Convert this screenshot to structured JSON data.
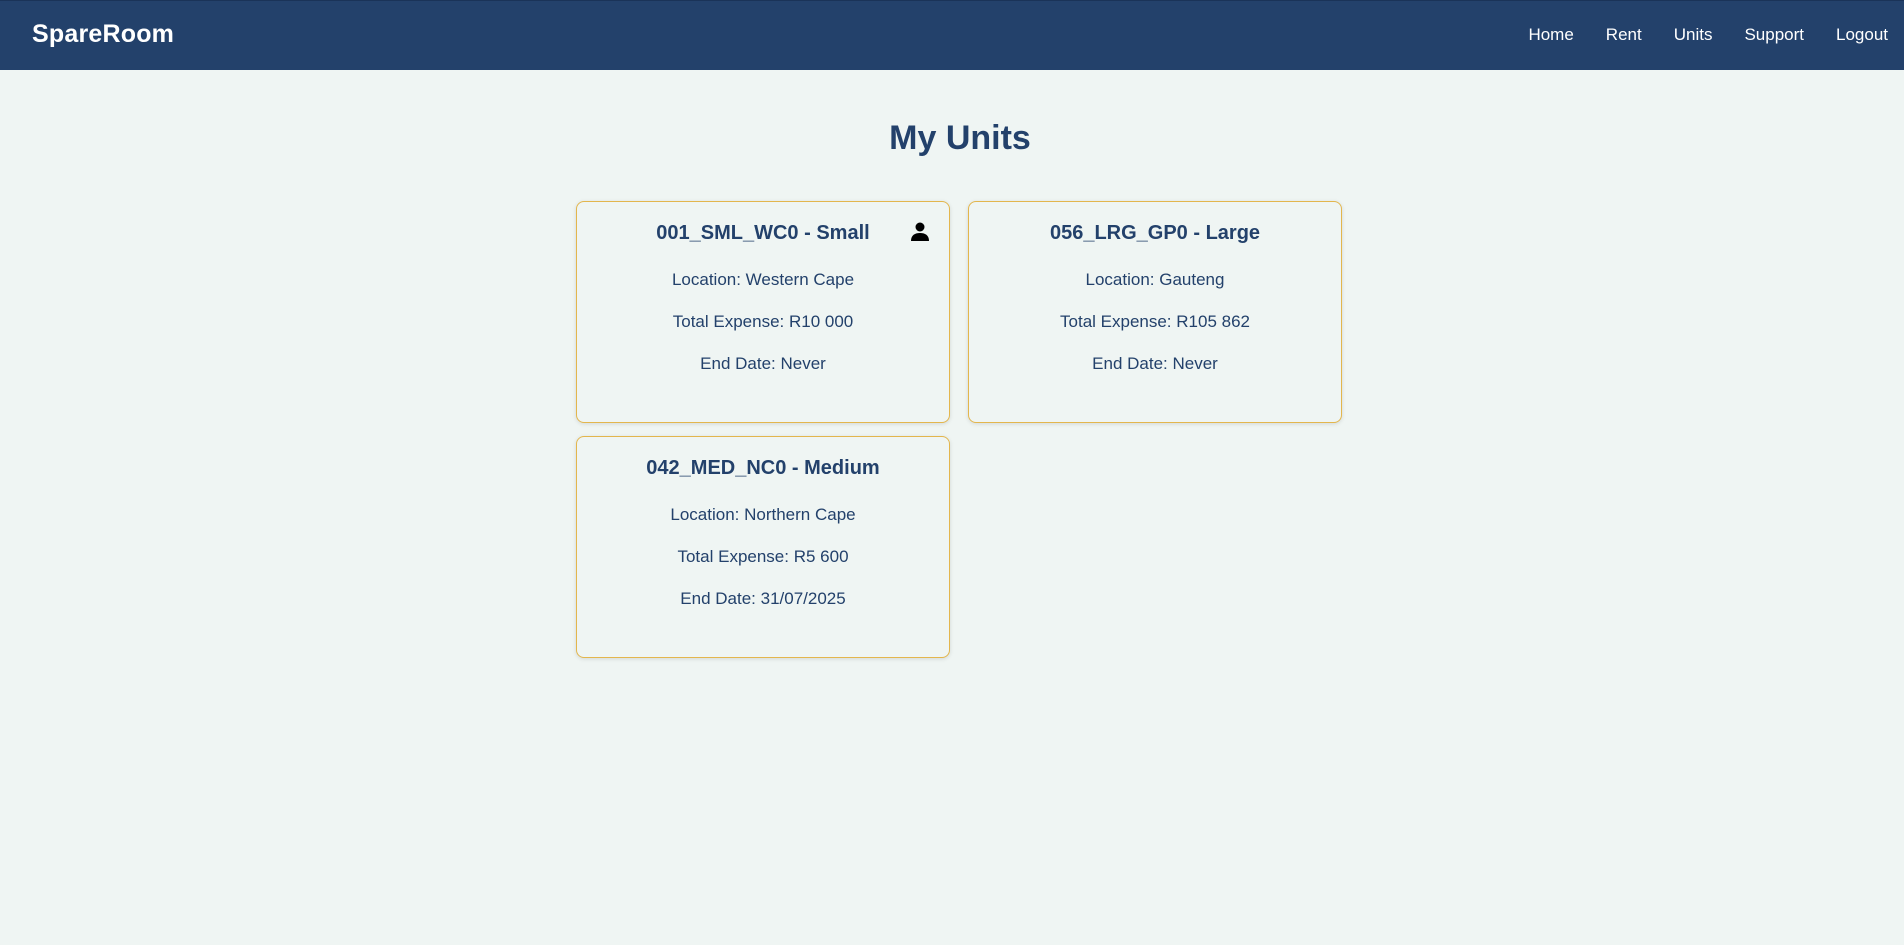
{
  "app": {
    "brand": "SpareRoom"
  },
  "nav": {
    "items": [
      {
        "label": "Home"
      },
      {
        "label": "Rent"
      },
      {
        "label": "Units"
      },
      {
        "label": "Support"
      },
      {
        "label": "Logout"
      }
    ]
  },
  "page": {
    "title": "My Units"
  },
  "units": [
    {
      "title": "001_SML_WC0 - Small",
      "location": "Location: Western Cape",
      "expense": "Total Expense: R10 000",
      "end_date": "End Date: Never",
      "icon": "person-icon"
    },
    {
      "title": "056_LRG_GP0 - Large",
      "location": "Location: Gauteng",
      "expense": "Total Expense: R105 862",
      "end_date": "End Date: Never"
    },
    {
      "title": "042_MED_NC0 - Medium",
      "location": "Location: Northern Cape",
      "expense": "Total Expense: R5 600",
      "end_date": "End Date: 31/07/2025"
    }
  ],
  "colors": {
    "header_bg": "#23416b",
    "page_bg": "#eff5f3",
    "card_border": "#e3b64d",
    "text": "#23416b"
  }
}
